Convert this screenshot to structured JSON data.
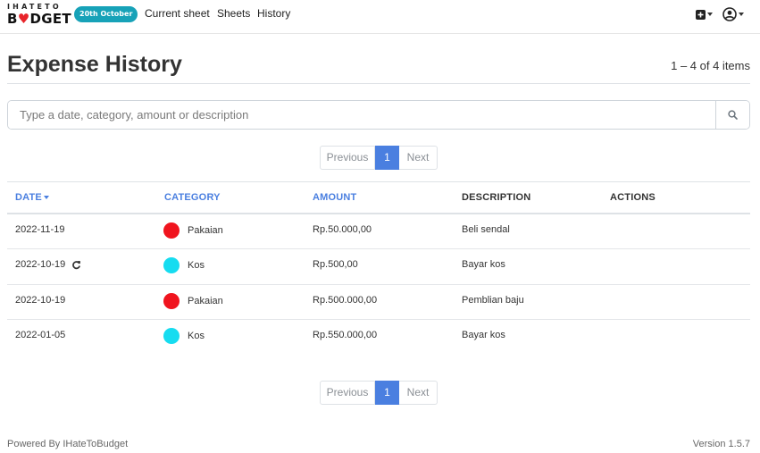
{
  "brand": {
    "line1": "IHATETO",
    "line2_pre": "B",
    "line2_heart": "♥",
    "line2_post": "DGET"
  },
  "nav": {
    "date_badge": "20th October",
    "links": [
      "Current sheet",
      "Sheets",
      "History"
    ],
    "add_icon": "plus-square-icon",
    "user_icon": "user-circle-icon"
  },
  "page": {
    "title": "Expense History",
    "items_count": "1 – 4 of 4 items"
  },
  "search": {
    "placeholder": "Type a date, category, amount or description",
    "value": "",
    "icon": "search-icon"
  },
  "pagination": {
    "previous": "Previous",
    "current": "1",
    "next": "Next"
  },
  "table": {
    "headers": {
      "date": "DATE",
      "category": "CATEGORY",
      "amount": "AMOUNT",
      "description": "DESCRIPTION",
      "actions": "ACTIONS"
    },
    "rows": [
      {
        "date": "2022-11-19",
        "recurring": false,
        "category": "Pakaian",
        "category_color": "#f0141e",
        "amount": "Rp.50.000,00",
        "description": "Beli sendal"
      },
      {
        "date": "2022-10-19",
        "recurring": true,
        "category": "Kos",
        "category_color": "#16dcf0",
        "amount": "Rp.500,00",
        "description": "Bayar kos"
      },
      {
        "date": "2022-10-19",
        "recurring": false,
        "category": "Pakaian",
        "category_color": "#f0141e",
        "amount": "Rp.500.000,00",
        "description": "Pemblian baju"
      },
      {
        "date": "2022-01-05",
        "recurring": false,
        "category": "Kos",
        "category_color": "#16dcf0",
        "amount": "Rp.550.000,00",
        "description": "Bayar kos"
      }
    ]
  },
  "footer": {
    "powered_by": "Powered By IHateToBudget",
    "version": "Version 1.5.7"
  },
  "colors": {
    "accent": "#4a7fe0",
    "badge": "#17a2b8"
  }
}
